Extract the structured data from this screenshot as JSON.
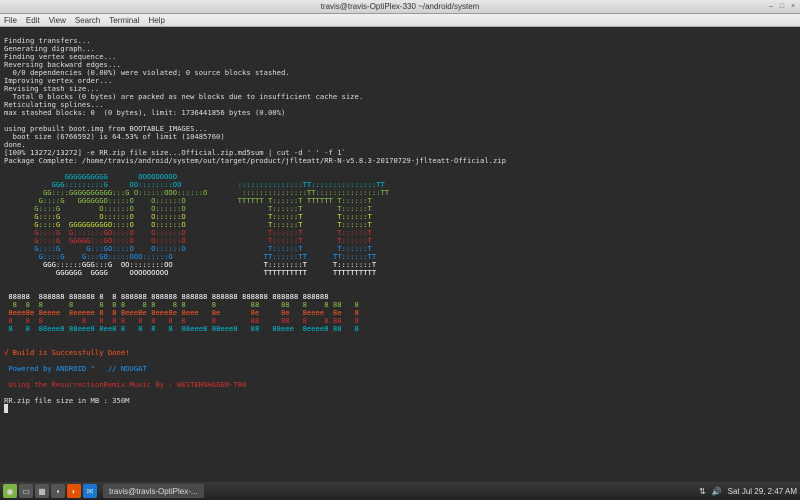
{
  "window": {
    "title": "travis@travis-OptiPlex-330 ~/android/system"
  },
  "menubar": [
    "File",
    "Edit",
    "View",
    "Search",
    "Terminal",
    "Help"
  ],
  "term": {
    "l1": "Finding transfers...",
    "l2": "Generating digraph...",
    "l3": "Finding vertex sequence...",
    "l4": "Reversing backward edges...",
    "l5": "  0/0 dependencies (0.00%) were violated; 0 source blocks stashed.",
    "l6": "Improving vertex order...",
    "l7": "Revising stash size...",
    "l8": "  Total 0 blocks (0 bytes) are packed as new blocks due to insufficient cache size.",
    "l9": "Reticulating splines...",
    "l10": "max stashed blocks: 0  (0 bytes), limit: 1736441856 bytes (0.00%)",
    "l12": "using prebuilt boot.img from BOOTABLE_IMAGES...",
    "l13": "  boot size (6766592) is 64.53% of limit (10485760)",
    "l14": "done.",
    "l15": "[100% 13272/13272] -e RR.zip file size...Official.zip.md5sum | cut -d ' ' -f 1`",
    "l16": "Package Complete: /home/travis/android/system/out/target/product/jflteatt/RR-N-v5.8.3-20170729-jflteatt-Official.zip"
  },
  "ascii": {
    "a1": "              GGGGGGGGGG       OOOOOOOOO",
    "a2": "           GGG:::::::::G     OO::::::::OO             :::::::::::::::TT:::::::::::::::TT",
    "a3": "         GG::::GGGGGGGGGG:::G O::::::OOO::::::O        :::::::::::::::TT:::::::::::::::TT",
    "a4": "        G::::G   GGGGGGO:::::O    O::::::O            TTTTTT T::::::T TTTTTT T::::::T",
    "a5": "       G::::G         O::::::O    O::::::O                   T::::::T        T::::::T",
    "a6": "       G::::G         O::::::O    O::::::O                   T::::::T        T::::::T",
    "a7": "       G::::G  GGGGGGGGGO::::O    O::::::O                   T::::::T        T::::::T",
    "a8": "       G::::G  G:::::::GO::::O    O::::::O                   T::::::T        T::::::T",
    "a9": "       G::::G  GGGGG:::GO::::O    O::::::O                   T::::::T        T::::::T",
    "a10": "       G::::G      G:::GO::::O    O::::::O                   T::::::T        T::::::T",
    "a11": "        G::::G    G:::GO:::::OOO::::::O                     TT::::::TT      TT::::::TT",
    "a12": "         GGG::::::GGG:::G  OO::::::::OO                     T::::::::T      T::::::::T",
    "a13": "            GGGGGG  GGGG     OOOOOOOOO                      TTTTTTTTTT      TTTTTTTTTT",
    "b1": " 88888  888888 888888 8  8 888888 888888 888888 888888 888888 888888 888888",
    "b2": "  8  8  8      8      8  8 8    8 8    8 8      8        88     88   8    8 88   8",
    "b3": " 8eee8e 8eeee  8eeeee 8  8 8eee8e 8eee8e 8eee   8e       8e     8e   8eeee  8e   8",
    "b4": " 8   8  8         8   8  8 8   8  8   8  8      8        88     88   8    8 88   8",
    "b5": " 8   8  88eee8 88eee8 8ee8 8   8  8   8  88eee8 88eee8   88   88eee  8eeee8 88   8"
  },
  "footer": {
    "done": "√ Build is Successfully Done!",
    "powered": " Powered by ANDROID \"   // NOUGAT",
    "remix": " Using the ResurrectionRemix Music By : WESTERNHAGEN-T88",
    "size": "RR.zip file size in MB : 350M",
    "prompt": " "
  },
  "taskbar": {
    "app": "travis@travis-OptiPlex-...",
    "date": "Sat Jul 29, 2:47 AM"
  }
}
